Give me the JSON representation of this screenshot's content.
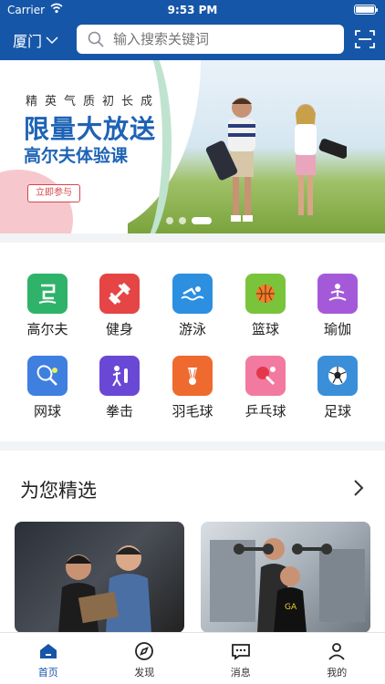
{
  "status": {
    "carrier": "Carrier",
    "time": "9:53 PM"
  },
  "header": {
    "city": "厦门",
    "search_placeholder": "输入搜索关键词"
  },
  "banner": {
    "slogan": "精英气质初长成",
    "headline": "限量大放送",
    "subheadline": "高尔夫体验课",
    "cta": "立即参与",
    "page_count": 3,
    "active_page": 3
  },
  "categories": [
    {
      "label": "高尔夫",
      "icon": "golf-icon",
      "color": "#2fb36a"
    },
    {
      "label": "健身",
      "icon": "dumbbell-icon",
      "color": "#e54545"
    },
    {
      "label": "游泳",
      "icon": "swimming-icon",
      "color": "#2c8fe0"
    },
    {
      "label": "篮球",
      "icon": "basketball-icon",
      "color": "#7ac43c"
    },
    {
      "label": "瑜伽",
      "icon": "yoga-icon",
      "color": "#a45ad8"
    },
    {
      "label": "网球",
      "icon": "tennis-icon",
      "color": "#3f7fe0"
    },
    {
      "label": "拳击",
      "icon": "boxing-icon",
      "color": "#6a48d6"
    },
    {
      "label": "羽毛球",
      "icon": "badminton-icon",
      "color": "#ef6a2e"
    },
    {
      "label": "乒乓球",
      "icon": "pingpong-icon",
      "color": "#f27aa0"
    },
    {
      "label": "足球",
      "icon": "football-icon",
      "color": "#3b8fd9"
    }
  ],
  "featured": {
    "title": "为您精选"
  },
  "tabs": [
    {
      "label": "首页",
      "icon": "home-icon",
      "active": true
    },
    {
      "label": "发现",
      "icon": "compass-icon",
      "active": false
    },
    {
      "label": "消息",
      "icon": "message-icon",
      "active": false
    },
    {
      "label": "我的",
      "icon": "profile-icon",
      "active": false
    }
  ],
  "colors": {
    "brand": "#1656a8",
    "banner_text": "#1e63b5",
    "cta": "#d6454b"
  }
}
